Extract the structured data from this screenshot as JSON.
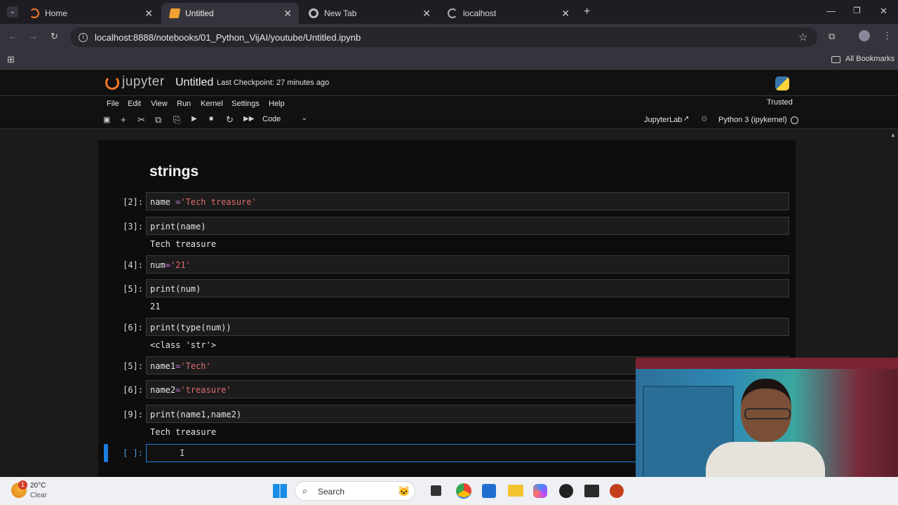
{
  "browser": {
    "tabs": [
      {
        "label": "Home"
      },
      {
        "label": "Untitled"
      },
      {
        "label": "New Tab"
      },
      {
        "label": "localhost"
      }
    ],
    "url": "localhost:8888/notebooks/01_Python_VijAI/youtube/Untitled.ipynb",
    "bookmarks_label": "All Bookmarks"
  },
  "jupyter": {
    "logo_text": "jupyter",
    "title": "Untitled",
    "checkpoint": "Last Checkpoint: 27 minutes ago",
    "trusted": "Trusted",
    "menu": [
      "File",
      "Edit",
      "View",
      "Run",
      "Kernel",
      "Settings",
      "Help"
    ],
    "cell_type": "Code",
    "jupyterlab_label": "JupyterLab",
    "kernel": "Python 3 (ipykernel)"
  },
  "notebook": {
    "heading": "strings",
    "cells": [
      {
        "prompt": "[2]:",
        "code_a": "name ",
        "op": "=",
        "code_b": "'Tech treasure'",
        "output": ""
      },
      {
        "prompt": "[3]:",
        "code_a": "print(name)",
        "op": "",
        "code_b": "",
        "output": "Tech treasure"
      },
      {
        "prompt": "[4]:",
        "code_a": "num",
        "op": "=",
        "code_b": "'21'",
        "output": ""
      },
      {
        "prompt": "[5]:",
        "code_a": "print(num)",
        "op": "",
        "code_b": "",
        "output": "21"
      },
      {
        "prompt": "[6]:",
        "code_a": "print(type(num))",
        "op": "",
        "code_b": "",
        "output": "<class 'str'>"
      },
      {
        "prompt": "[5]:",
        "code_a": "name1",
        "op": "=",
        "code_b": "'Tech'",
        "output": ""
      },
      {
        "prompt": "[6]:",
        "code_a": "name2",
        "op": "=",
        "code_b": "'treasure'",
        "output": ""
      },
      {
        "prompt": "[9]:",
        "code_a": "print(name1,name2)",
        "op": "",
        "code_b": "",
        "output": "Tech treasure"
      },
      {
        "prompt": "[ ]:",
        "code_a": "",
        "op": "",
        "code_b": "",
        "output": ""
      }
    ]
  },
  "taskbar": {
    "weather_temp": "20°C",
    "weather_desc": "Clear",
    "weather_badge": "1",
    "search_placeholder": "Search"
  }
}
